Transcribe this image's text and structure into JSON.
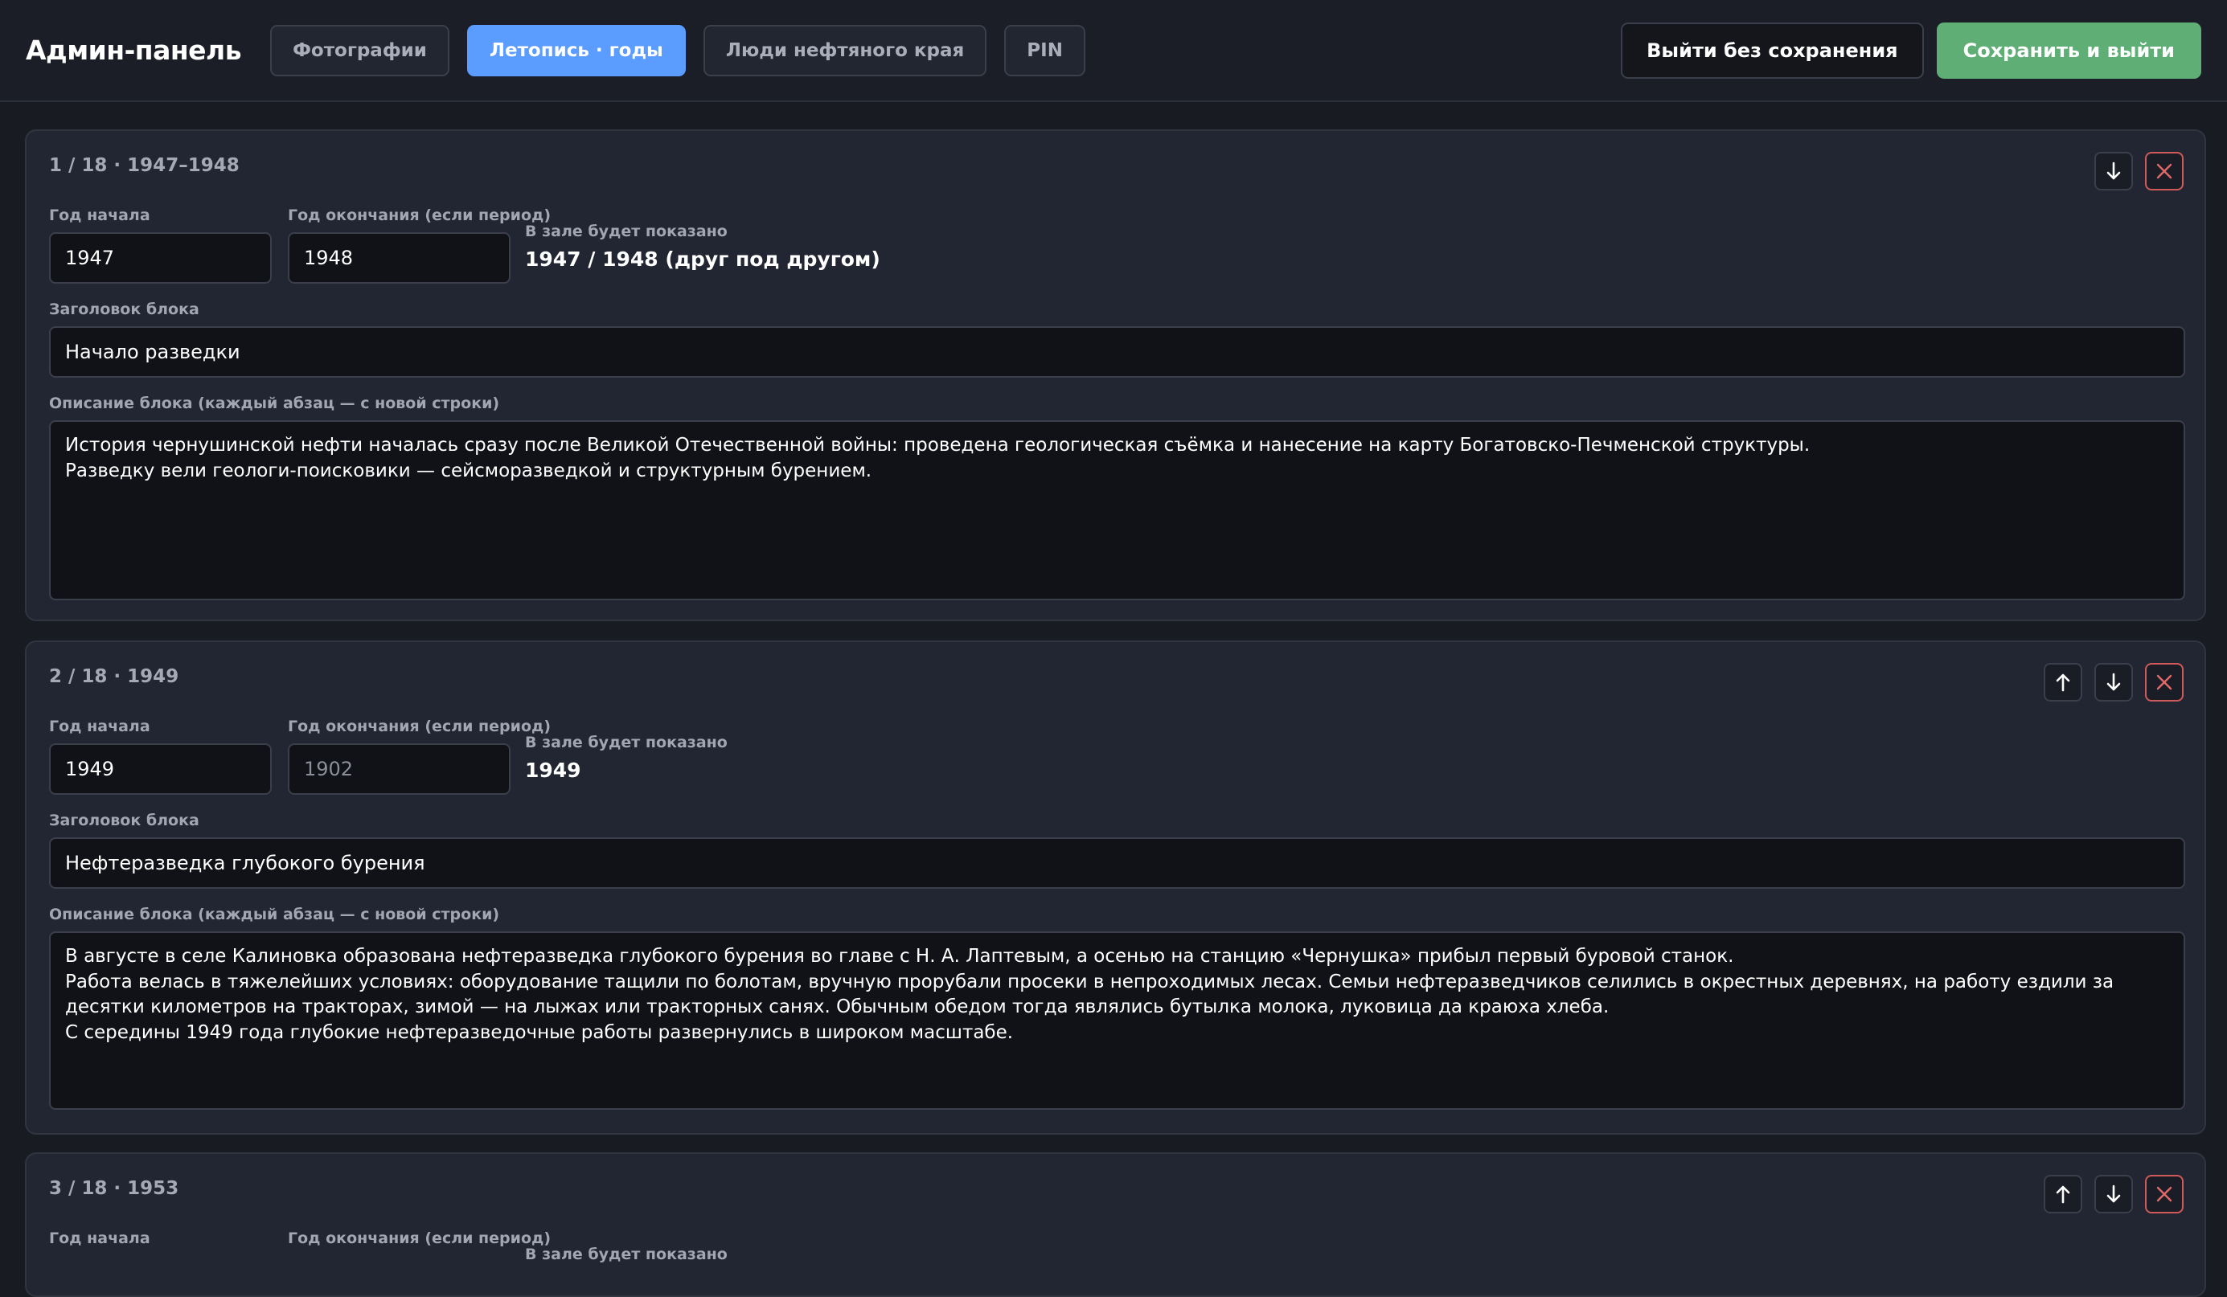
{
  "header": {
    "brand": "Админ-панель",
    "tabs": [
      {
        "label": "Фотографии"
      },
      {
        "label": "Летопись · годы"
      },
      {
        "label": "Люди нефтяного края"
      },
      {
        "label": "PIN"
      }
    ],
    "exit_label": "Выйти без сохранения",
    "save_label": "Сохранить и выйти"
  },
  "labels": {
    "start_year": "Год начала",
    "end_year": "Год окончания (если период)",
    "shown_in_hall": "В зале будет показано",
    "block_title": "Заголовок блока",
    "block_desc": "Описание блока (каждый абзац — с новой строки)"
  },
  "cards": [
    {
      "heading": "1 / 18 · 1947–1948",
      "start_year": "1947",
      "end_year": "1948",
      "shown": "1947 / 1948 (друг под другом)",
      "title": "Начало разведки",
      "description": "История чернушинской нефти началась сразу после Великой Отечественной войны: проведена геологическая съёмка и нанесение на карту Богатовско-Печменской структуры.\nРазведку вели геологи-поисковики — сейсморазведкой и структурным бурением."
    },
    {
      "heading": "2 / 18 · 1949",
      "start_year": "1949",
      "end_year_placeholder": "1902",
      "shown": "1949",
      "title": "Нефтеразведка глубокого бурения",
      "description": "В августе в селе Калиновка образована нефтеразведка глубокого бурения во главе с Н. А. Лаптевым, а осенью на станцию «Чернушка» прибыл первый буровой станок.\nРабота велась в тяжелейших условиях: оборудование тащили по болотам, вручную прорубали просеки в непроходимых лесах. Семьи нефтеразведчиков селились в окрестных деревнях, на работу ездили за десятки километров на тракторах, зимой — на лыжах или тракторных санях. Обычным обедом тогда являлись бутылка молока, луковица да краюха хлеба.\nС середины 1949 года глубокие нефтеразведочные работы развернулись в широком масштабе."
    },
    {
      "heading": "3 / 18 · 1953",
      "shown": ""
    }
  ],
  "icons": {
    "move_up": "arrow-up-icon",
    "move_down": "arrow-down-icon",
    "delete": "close-icon"
  },
  "colors": {
    "accent": "#5a9cff",
    "save": "#5fae75",
    "danger": "#d05a5a"
  }
}
